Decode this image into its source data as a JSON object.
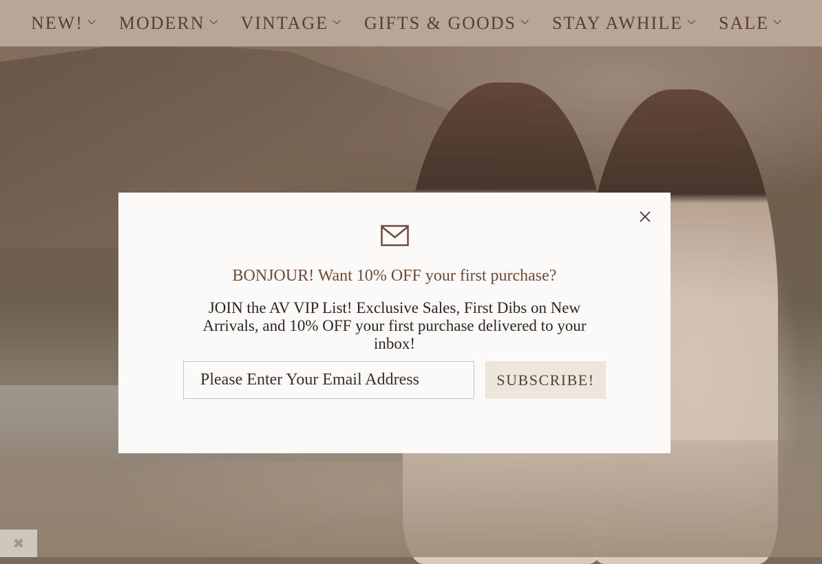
{
  "nav": {
    "items": [
      {
        "label": "NEW!"
      },
      {
        "label": "MODERN"
      },
      {
        "label": "VINTAGE"
      },
      {
        "label": "GIFTS & GOODS"
      },
      {
        "label": "STAY AWHILE"
      },
      {
        "label": "SALE"
      }
    ]
  },
  "modal": {
    "heading": "BONJOUR! Want 10% OFF your first purchase?",
    "subtext": "JOIN the AV VIP List! Exclusive Sales, First Dibs on New Arrivals, and 10% OFF your first purchase delivered to your inbox!",
    "email_placeholder": "Please Enter Your Email Address",
    "subscribe_label": "SUBSCRIBE!"
  },
  "icons": {
    "mail": "mail-icon",
    "close": "close-icon",
    "chevron": "chevron-down-icon",
    "corner": "close-icon"
  },
  "colors": {
    "nav_bg": "#b8a797",
    "nav_text": "#5a3e2f",
    "modal_bg": "#fcfaf8",
    "heading_text": "#6e4a37",
    "button_bg": "#ede6dd"
  }
}
